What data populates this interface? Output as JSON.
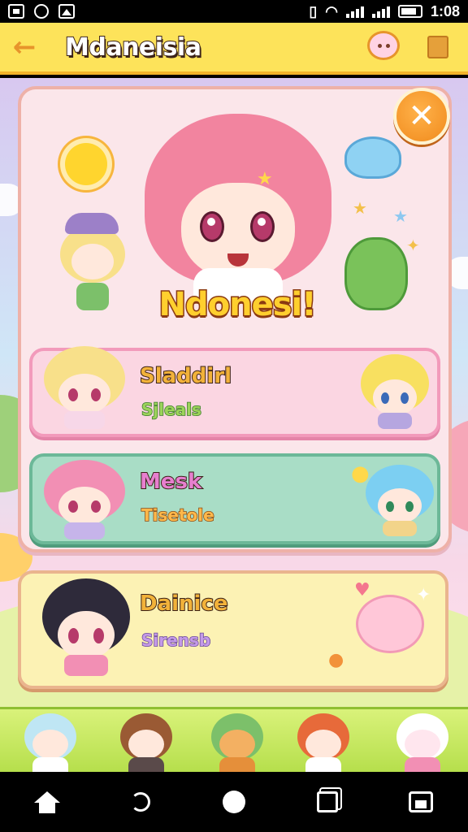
{
  "status_bar": {
    "time": "1:08"
  },
  "header": {
    "back_icon": "arrow-left-icon",
    "title": "Mdaneisia",
    "chat_icon": "chat-bubble-icon",
    "book_icon": "book-icon"
  },
  "panel": {
    "close_icon": "close-icon",
    "banner": "Ndonesi!"
  },
  "cards": [
    {
      "name": "Sladdirl",
      "subtitle": "Sjleals"
    },
    {
      "name": "Mesk",
      "subtitle": "Tisetole"
    },
    {
      "name": "Dainice",
      "subtitle": "Sirensb"
    }
  ],
  "colors": {
    "header_bg": "#fde35a",
    "card1_bg": "#fbd6e2",
    "card2_bg": "#a9ddc6",
    "card3_bg": "#fcf2b4",
    "accent": "#f08a1c",
    "card1_subtitle": "#9cd35a",
    "card2_name": "#e77fcf",
    "card2_subtitle": "#ffb84a",
    "card3_name": "#f2b23a",
    "card3_subtitle": "#c49ae8",
    "card1_name": "#f2b23a"
  },
  "navigation": {
    "icons": [
      "home-icon",
      "back-icon",
      "circle-home-icon",
      "recent-apps-icon",
      "menu-grid-icon"
    ]
  }
}
